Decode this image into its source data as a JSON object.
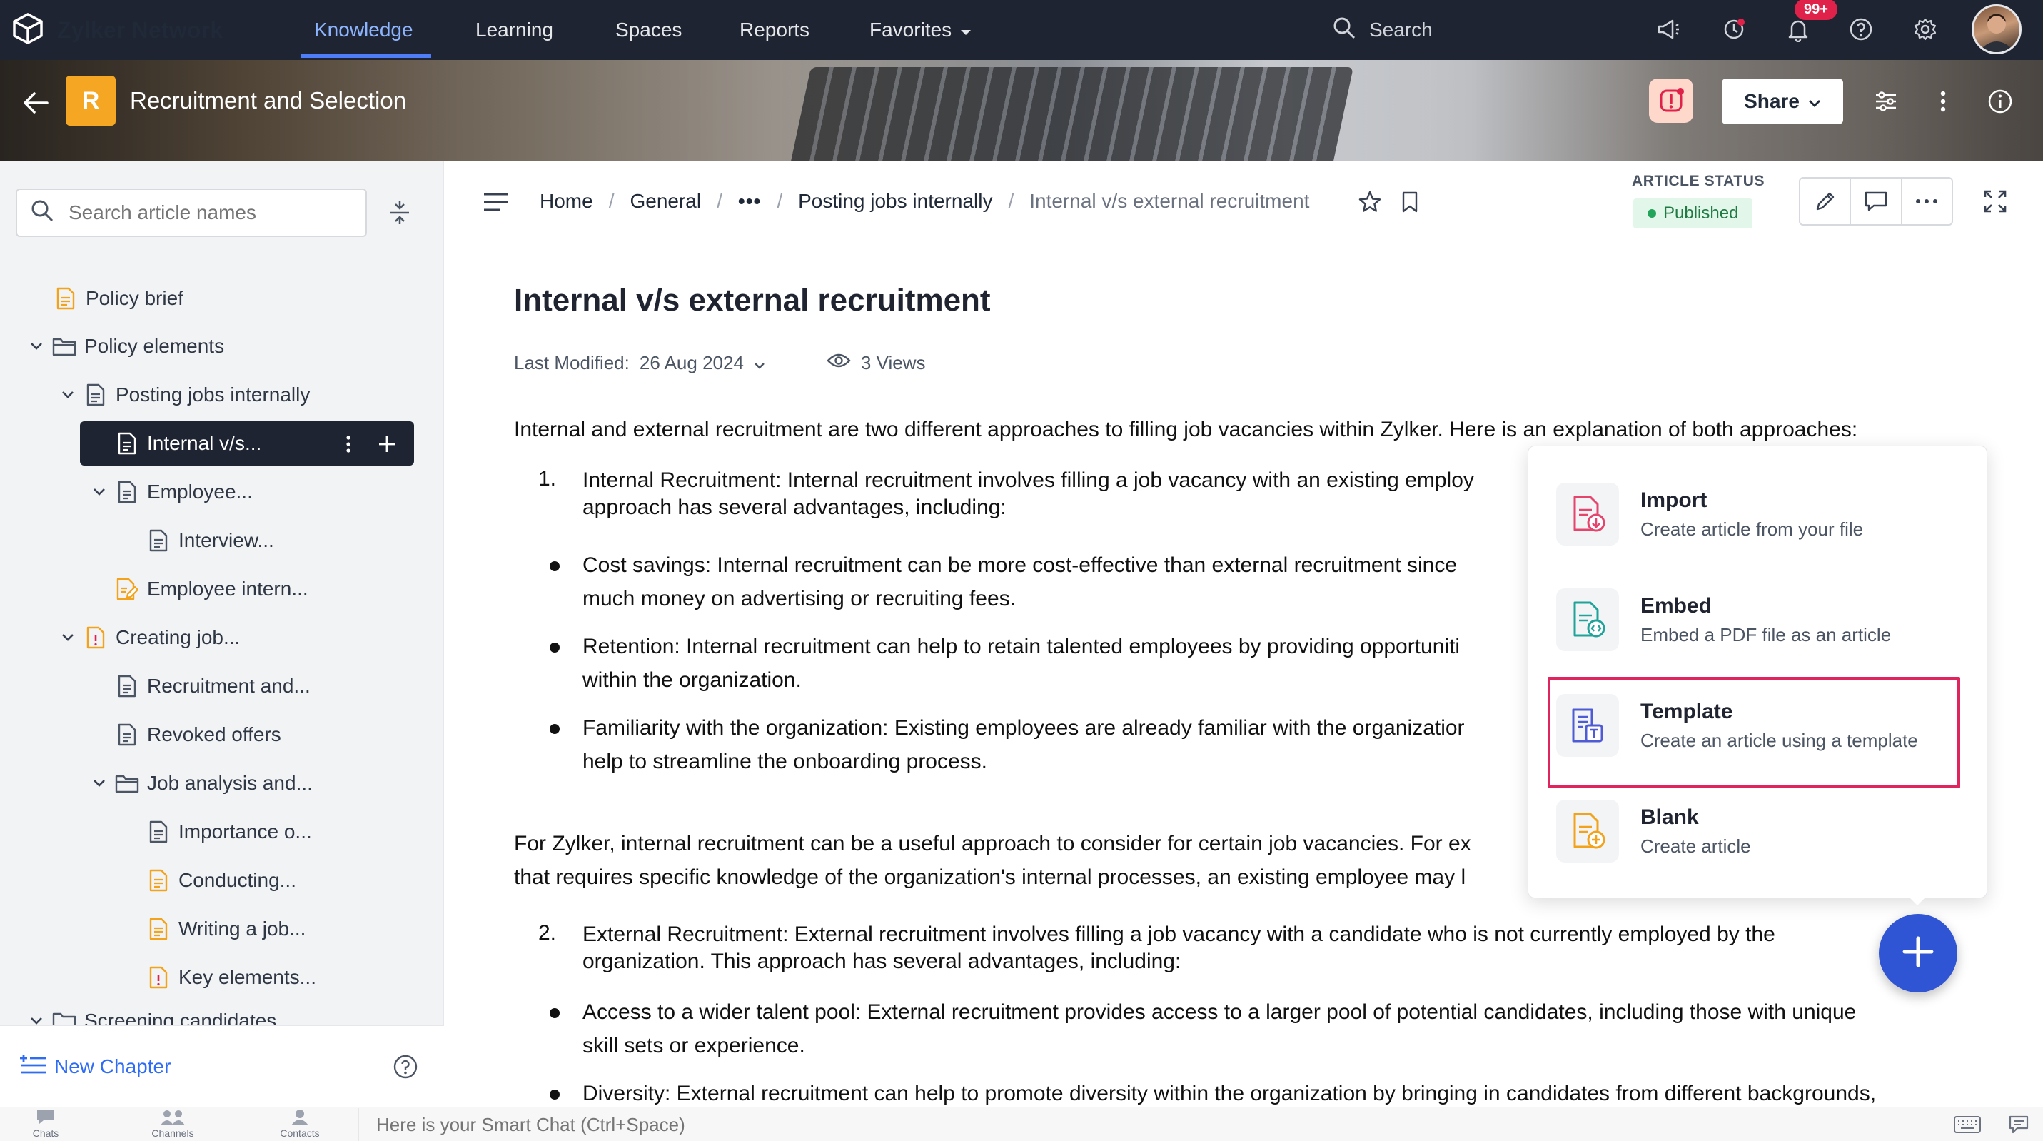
{
  "brand": {
    "name": "Zylker Network"
  },
  "nav": {
    "items": [
      "Knowledge",
      "Learning",
      "Spaces",
      "Reports",
      "Favorites"
    ],
    "active": "Knowledge",
    "search_label": "Search",
    "notification_badge": "99+"
  },
  "space": {
    "badge": "R",
    "title": "Recruitment and Selection",
    "share_label": "Share"
  },
  "sidebar": {
    "search_placeholder": "Search article names",
    "tree": [
      {
        "label": "Policy brief",
        "type": "doc-orange"
      },
      {
        "label": "Policy elements",
        "type": "folder"
      },
      {
        "label": "Posting jobs internally",
        "type": "doc"
      },
      {
        "label": "Internal v/s...",
        "type": "doc",
        "active": true
      },
      {
        "label": "Employee...",
        "type": "doc"
      },
      {
        "label": "Interview...",
        "type": "doc"
      },
      {
        "label": "Employee intern...",
        "type": "doc-edit"
      },
      {
        "label": "Creating job...",
        "type": "doc-orange"
      },
      {
        "label": "Recruitment and...",
        "type": "doc"
      },
      {
        "label": "Revoked offers",
        "type": "doc"
      },
      {
        "label": "Job analysis and...",
        "type": "folder"
      },
      {
        "label": "Importance o...",
        "type": "doc"
      },
      {
        "label": "Conducting...",
        "type": "doc-orange"
      },
      {
        "label": "Writing a job...",
        "type": "doc-orange"
      },
      {
        "label": "Key elements...",
        "type": "doc-orange"
      },
      {
        "label": "Screening candidates",
        "type": "folder"
      }
    ],
    "new_chapter": "New Chapter"
  },
  "breadcrumb": {
    "items": [
      "Home",
      "General",
      "•••",
      "Posting jobs internally",
      "Internal v/s external recruitment"
    ]
  },
  "status": {
    "label": "ARTICLE STATUS",
    "value": "Published"
  },
  "article": {
    "title": "Internal v/s external recruitment",
    "last_modified_label": "Last Modified:",
    "last_modified_date": "26 Aug 2024",
    "views": "3 Views",
    "intro": "Internal and external recruitment are two different approaches to filling job vacancies within Zylker. Here is an explanation of both approaches:",
    "item1_num": "1.",
    "item1_line1": "Internal Recruitment: Internal recruitment involves filling a job vacancy with an existing employ",
    "item1_line2": "approach has several advantages, including:",
    "b1_line1": "Cost savings: Internal recruitment can be more cost-effective than external recruitment since",
    "b1_line2": "much money on advertising or recruiting fees.",
    "b2_line1": "Retention: Internal recruitment can help to retain talented employees by providing opportuniti",
    "b2_line2": "within the organization.",
    "b3_line1": "Familiarity with the organization: Existing employees are already familiar with the organizatior",
    "b3_line2": "help to streamline the onboarding process.",
    "zylker_line1": "For Zylker, internal recruitment can be a useful approach to consider for certain job vacancies. For ex",
    "zylker_line2": "that requires specific knowledge of the organization's internal processes, an existing employee may l",
    "item2_num": "2.",
    "item2_line1": "External Recruitment: External recruitment involves filling a job vacancy with a candidate who is not currently employed by the",
    "item2_line2": "organization. This approach has several advantages, including:",
    "b4_line1": "Access to a wider talent pool: External recruitment provides access to a larger pool of potential candidates, including those with unique",
    "b4_line2": "skill sets or experience.",
    "b5_line1": "Diversity: External recruitment can help to promote diversity within the organization by bringing in candidates from different backgrounds,"
  },
  "create_menu": [
    {
      "title": "Import",
      "desc": "Create article from your file",
      "icon": "import-file-icon",
      "color": "#e5446d"
    },
    {
      "title": "Embed",
      "desc": "Embed a PDF file as an article",
      "icon": "embed-file-icon",
      "color": "#22a39a"
    },
    {
      "title": "Template",
      "desc": "Create an article using a template",
      "icon": "template-file-icon",
      "color": "#4f5bd5",
      "highlighted": true
    },
    {
      "title": "Blank",
      "desc": "Create article",
      "icon": "blank-file-icon",
      "color": "#f2a31b"
    }
  ],
  "bottom_bar": {
    "items": [
      "Chats",
      "Channels",
      "Contacts"
    ],
    "smartchat_placeholder": "Here is your Smart Chat (Ctrl+Space)"
  }
}
